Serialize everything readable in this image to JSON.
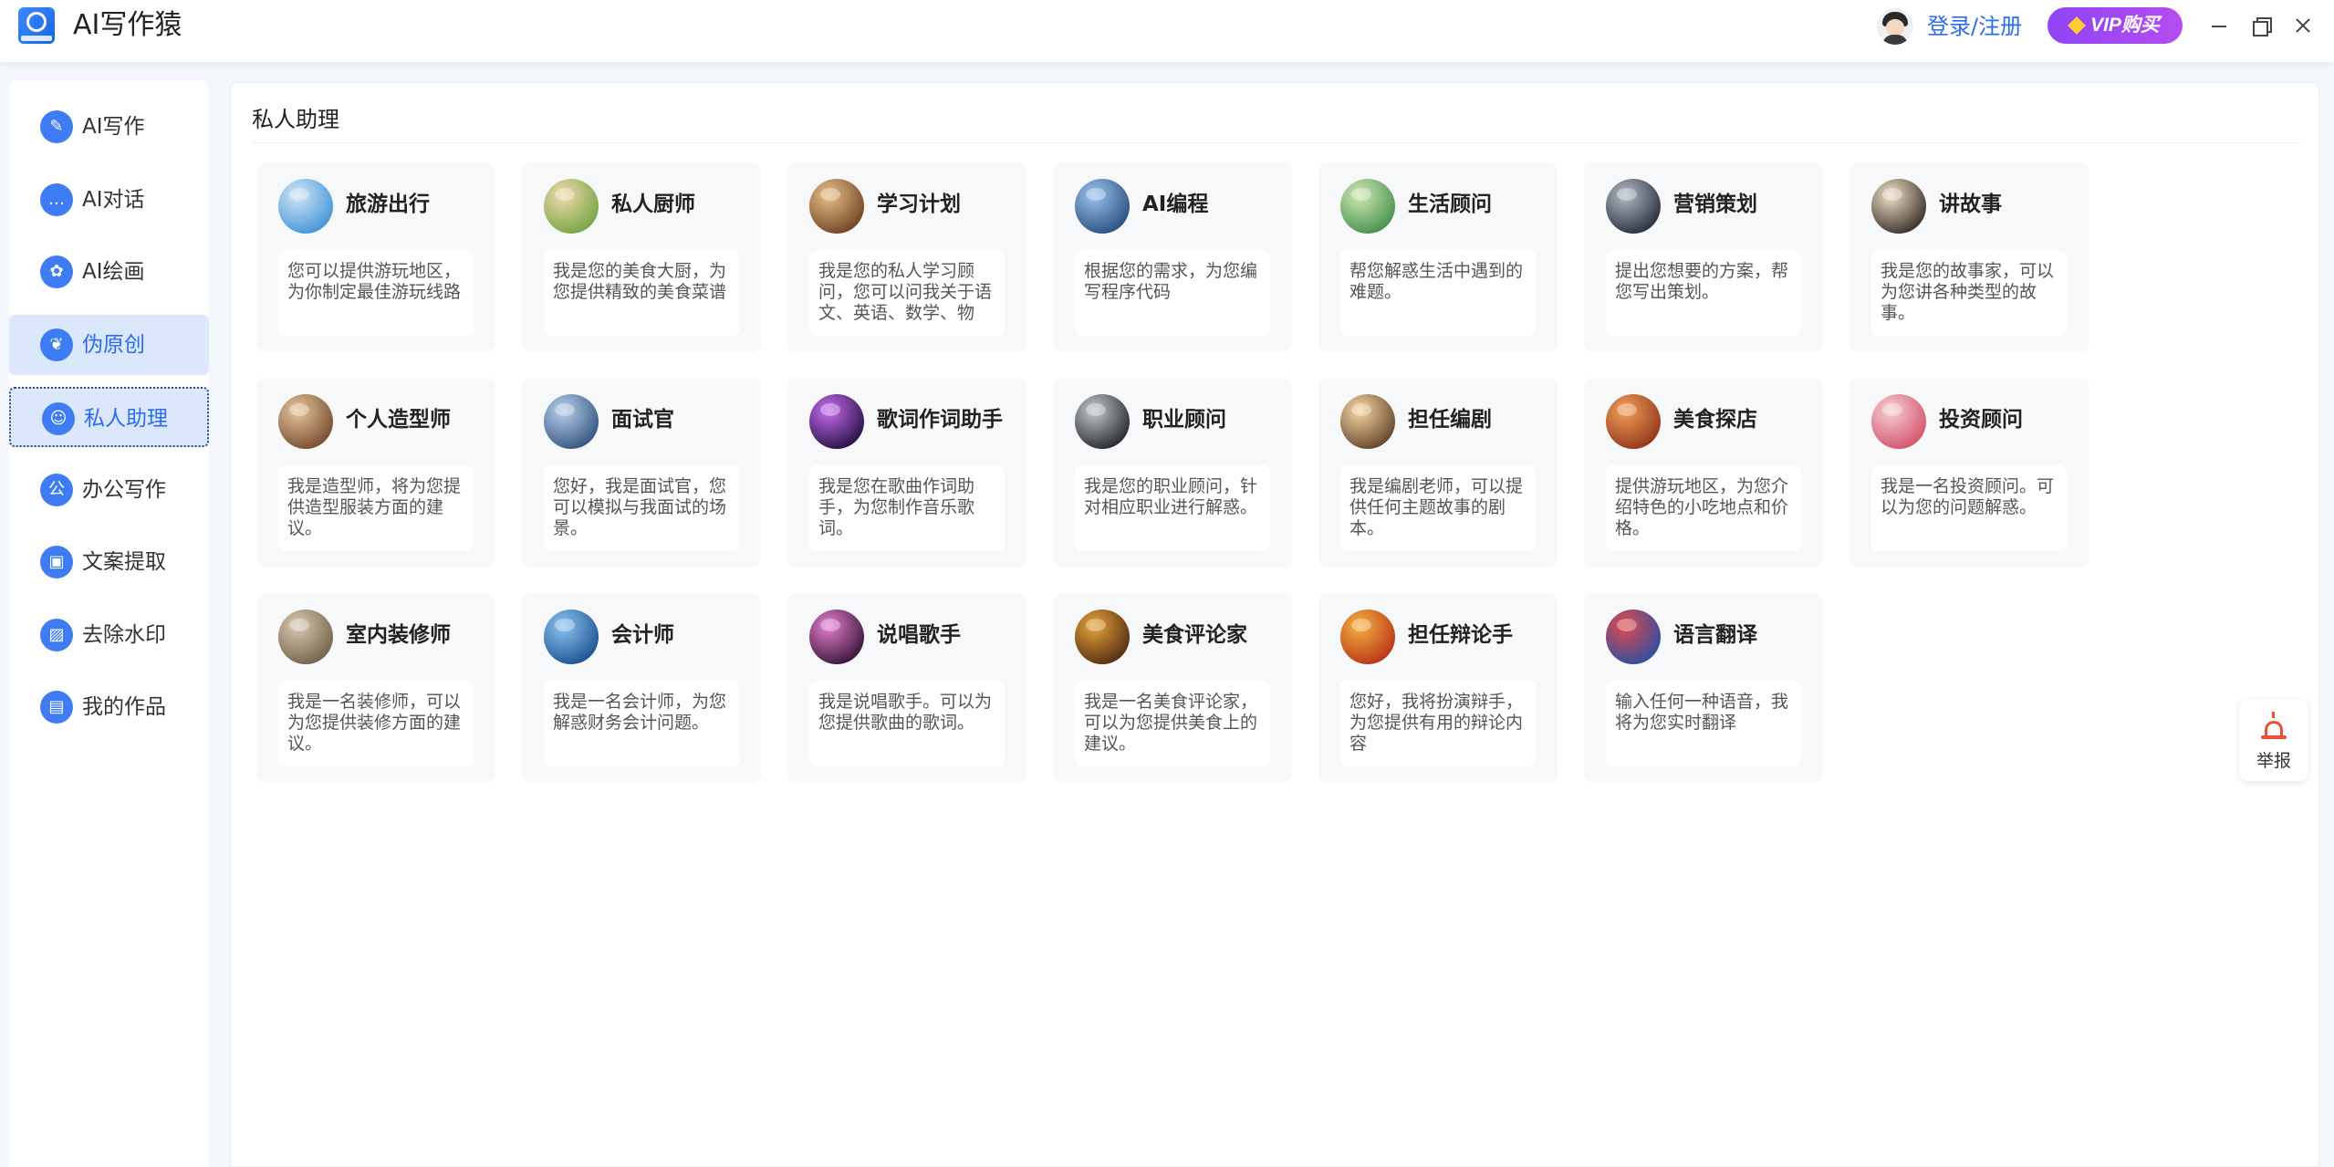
{
  "app": {
    "title": "AI写作猿",
    "login_label": "登录/注册",
    "vip_label": "VIP购买",
    "accent_color": "#2b6cf0",
    "vip_color": "#9b48f3"
  },
  "sidebar": {
    "items": [
      {
        "label": "AI写作",
        "icon": "pencil-icon",
        "glyph": "✎"
      },
      {
        "label": "AI对话",
        "icon": "chat-icon",
        "glyph": "…"
      },
      {
        "label": "AI绘画",
        "icon": "palette-icon",
        "glyph": "✿"
      },
      {
        "label": "伪原创",
        "icon": "leaf-icon",
        "glyph": "❦",
        "active": true
      },
      {
        "label": "私人助理",
        "icon": "assistant-icon",
        "glyph": "☺",
        "selected": true
      },
      {
        "label": "办公写作",
        "icon": "office-icon",
        "glyph": "公"
      },
      {
        "label": "文案提取",
        "icon": "extract-icon",
        "glyph": "▣"
      },
      {
        "label": "去除水印",
        "icon": "image-icon",
        "glyph": "▨"
      },
      {
        "label": "我的作品",
        "icon": "folder-icon",
        "glyph": "▤"
      }
    ]
  },
  "main": {
    "section_title": "私人助理",
    "cards": [
      {
        "title": "旅游出行",
        "desc": "您可以提供游玩地区，为你制定最佳游玩线路",
        "avatar": "travel-avatar",
        "colors": [
          "#cfe6f7",
          "#3b8fd6"
        ]
      },
      {
        "title": "私人厨师",
        "desc": "我是您的美食大厨，为您提供精致的美食菜谱",
        "avatar": "chef-avatar",
        "colors": [
          "#f3d9b0",
          "#6aa33a"
        ]
      },
      {
        "title": "学习计划",
        "desc": "我是您的私人学习顾问，您可以问我关于语文、英语、数学、物",
        "avatar": "books-avatar",
        "colors": [
          "#e7c18a",
          "#6b3a1c"
        ]
      },
      {
        "title": "AI编程",
        "desc": "根据您的需求，为您编写程序代码",
        "avatar": "robot-avatar",
        "colors": [
          "#9cc3ee",
          "#23477a"
        ]
      },
      {
        "title": "生活顾问",
        "desc": "帮您解惑生活中遇到的难题。",
        "avatar": "nature-avatar",
        "colors": [
          "#cfe9b5",
          "#3f8a46"
        ]
      },
      {
        "title": "营销策划",
        "desc": "提出您想要的方案，帮您写出策划。",
        "avatar": "marketing-avatar",
        "colors": [
          "#b4bcc8",
          "#1e2633"
        ]
      },
      {
        "title": "讲故事",
        "desc": "我是您的故事家，可以为您讲各种类型的故事。",
        "avatar": "storyteller-avatar",
        "colors": [
          "#f1e2c7",
          "#2b2320"
        ]
      },
      {
        "title": "个人造型师",
        "desc": "我是造型师，将为您提供造型服装方面的建议。",
        "avatar": "stylist-avatar",
        "colors": [
          "#e8c79d",
          "#6e4428"
        ]
      },
      {
        "title": "面试官",
        "desc": "您好，我是面试官，您可以模拟与我面试的场景。",
        "avatar": "interviewer-avatar",
        "colors": [
          "#b9d1ec",
          "#2b4d7a"
        ]
      },
      {
        "title": "歌词作词助手",
        "desc": "我是您在歌曲作词助手，为您制作音乐歌词。",
        "avatar": "lyrics-avatar",
        "colors": [
          "#c86cf0",
          "#1a0b3a"
        ]
      },
      {
        "title": "职业顾问",
        "desc": "我是您的职业顾问，针对相应职业进行解惑。",
        "avatar": "career-avatar",
        "colors": [
          "#c5c9cf",
          "#1b1d22"
        ]
      },
      {
        "title": "担任编剧",
        "desc": "我是编剧老师，可以提供任何主题故事的剧本。",
        "avatar": "screenwriter-avatar",
        "colors": [
          "#f6d8a4",
          "#5a3a22"
        ]
      },
      {
        "title": "美食探店",
        "desc": "提供游玩地区，为您介绍特色的小吃地点和价格。",
        "avatar": "food-explore-avatar",
        "colors": [
          "#f3a05a",
          "#8a2f16"
        ]
      },
      {
        "title": "投资顾问",
        "desc": "我是一名投资顾问。可以为您的问题解惑。",
        "avatar": "investment-avatar",
        "colors": [
          "#f6cfd5",
          "#d24b62"
        ]
      },
      {
        "title": "室内装修师",
        "desc": "我是一名装修师，可以为您提供装修方面的建议。",
        "avatar": "interior-avatar",
        "colors": [
          "#d9cbb4",
          "#6e5a42"
        ]
      },
      {
        "title": "会计师",
        "desc": "我是一名会计师，为您解惑财务会计问题。",
        "avatar": "accountant-avatar",
        "colors": [
          "#8fc4f2",
          "#144a8c"
        ]
      },
      {
        "title": "说唱歌手",
        "desc": "我是说唱歌手。可以为您提供歌曲的歌词。",
        "avatar": "rapper-avatar",
        "colors": [
          "#e67fd0",
          "#2a0f2c"
        ]
      },
      {
        "title": "美食评论家",
        "desc": "我是一名美食评论家，可以为您提供美食上的建议。",
        "avatar": "food-critic-avatar",
        "colors": [
          "#e6a43a",
          "#4a2410"
        ]
      },
      {
        "title": "担任辩论手",
        "desc": "您好，我将扮演辩手，为您提供有用的辩论内容",
        "avatar": "debater-avatar",
        "colors": [
          "#f4b340",
          "#b52a16"
        ]
      },
      {
        "title": "语言翻译",
        "desc": "输入任何一种语音，我将为您实时翻译",
        "avatar": "translator-avatar",
        "colors": [
          "#e34a4a",
          "#1f4fa8"
        ]
      }
    ]
  },
  "report": {
    "label": "举报",
    "icon": "alarm-icon",
    "color": "#f04b35"
  }
}
